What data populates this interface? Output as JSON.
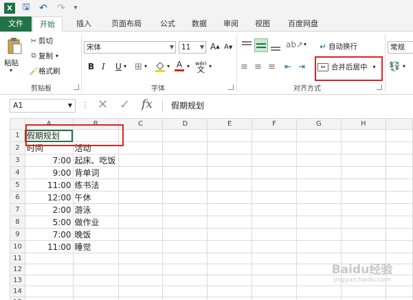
{
  "app": {
    "logo_text": "X"
  },
  "quick_access": {
    "save": "🖫",
    "undo": "↶",
    "redo": "↷",
    "customize": "▾"
  },
  "tabs": [
    "文件",
    "开始",
    "插入",
    "页面布局",
    "公式",
    "数据",
    "审阅",
    "视图",
    "百度网盘"
  ],
  "clipboard": {
    "paste": "粘贴",
    "cut": "剪切",
    "copy": "复制",
    "format_painter": "格式刷",
    "group_label": "剪贴板"
  },
  "font": {
    "name": "宋体",
    "size": "11",
    "grow": "A",
    "shrink": "A",
    "bold": "B",
    "italic": "I",
    "underline": "U",
    "phonetic": "wén",
    "group_label": "字体"
  },
  "alignment": {
    "wrap_text": "自动换行",
    "merge_center": "合并后居中",
    "group_label": "对齐方式"
  },
  "number": {
    "format": "常规"
  },
  "formula_bar": {
    "name_box": "A1",
    "cancel": "✕",
    "enter": "✓",
    "fx": "fx",
    "value": "假期规划"
  },
  "grid": {
    "columns": [
      "A",
      "B",
      "C",
      "D",
      "E",
      "F",
      "G",
      "H"
    ],
    "rows": [
      {
        "n": "1",
        "a": "假期规划",
        "b": ""
      },
      {
        "n": "2",
        "a": "时间",
        "b": "活动"
      },
      {
        "n": "3",
        "a": "7:00",
        "b": "起床、吃饭"
      },
      {
        "n": "4",
        "a": "9:00",
        "b": "背单词"
      },
      {
        "n": "5",
        "a": "11:00",
        "b": "练书法"
      },
      {
        "n": "6",
        "a": "12:00",
        "b": "午休"
      },
      {
        "n": "7",
        "a": "2:00",
        "b": "游泳"
      },
      {
        "n": "8",
        "a": "5:00",
        "b": "做作业"
      },
      {
        "n": "9",
        "a": "7:00",
        "b": "晚饭"
      },
      {
        "n": "10",
        "a": "11:00",
        "b": "睡觉"
      },
      {
        "n": "11",
        "a": "",
        "b": ""
      },
      {
        "n": "12",
        "a": "",
        "b": ""
      },
      {
        "n": "13",
        "a": "",
        "b": ""
      },
      {
        "n": "14",
        "a": "",
        "b": ""
      },
      {
        "n": "15",
        "a": "",
        "b": ""
      }
    ]
  },
  "watermark": {
    "text": "Baidu经验",
    "url": "jingyan.baidu.com"
  },
  "colors": {
    "excel_green": "#217346",
    "highlight_red": "#e0201b"
  }
}
